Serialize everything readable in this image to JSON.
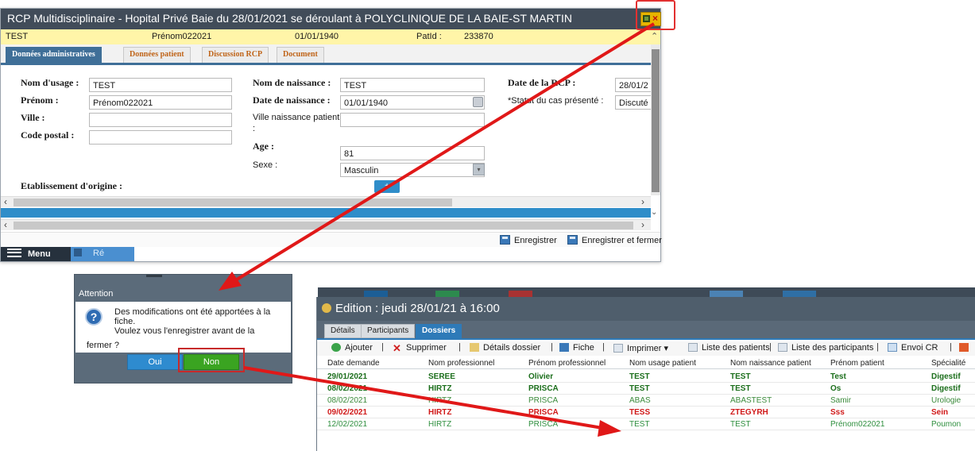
{
  "rcp_window": {
    "title": "RCP Multidisciplinaire - Hopital Privé Baie du 28/01/2021 se déroulant à POLYCLINIQUE DE LA BAIE-ST MARTIN",
    "patient_bar": {
      "nom": "TEST",
      "prenom": "Prénom022021",
      "date_naissance": "01/01/1940",
      "patid_label": "PatId :",
      "patid": "233870"
    },
    "tabs": [
      "Données administratives",
      "Données patient",
      "Discussion RCP",
      "Document"
    ],
    "form": {
      "nom_usage_label": "Nom d'usage :",
      "nom_usage": "TEST",
      "prenom_label": "Prénom :",
      "prenom": "Prénom022021",
      "ville_label": "Ville :",
      "ville": "",
      "code_postal_label": "Code postal :",
      "code_postal": "",
      "nom_naissance_label": "Nom de naissance :",
      "nom_naissance": "TEST",
      "date_naissance_label": "Date de naissance :",
      "date_naissance": "01/01/1940",
      "ville_naissance_label_1": "Ville naissance patient",
      "ville_naissance_label_2": ":",
      "ville_naissance": "",
      "age_label": "Age :",
      "age": "81",
      "sexe_label": "Sexe :",
      "sexe": "Masculin",
      "date_rcp_label": "Date de la RCP :",
      "date_rcp": "28/01/2",
      "statut_label": "*Statut du cas présenté :",
      "statut": "Discuté",
      "etablissement_label": "Etablissement d'origine :",
      "add_btn": "+"
    },
    "save_bar": {
      "save": "Enregistrer",
      "save_close": "Enregistrer et fermer"
    },
    "taskbar": {
      "menu": "Menu",
      "item": "Ré"
    }
  },
  "dialog": {
    "title": "Attention",
    "message_line1": "Des modifications ont été apportées à la fiche.",
    "message_line2": "Voulez vous l'enregistrer avant de la",
    "message_line3": "fermer ?",
    "yes": "Oui",
    "no": "Non"
  },
  "edition_window": {
    "title": "Edition : jeudi 28/01/21 à 16:00",
    "tabs": [
      "Détails",
      "Participants",
      "Dossiers"
    ],
    "toolbar": {
      "ajouter": "Ajouter",
      "supprimer": "Supprimer",
      "details_dossier": "Détails dossier",
      "fiche": "Fiche",
      "imprimer": "Imprimer",
      "liste_patients": "Liste des patients",
      "liste_participants": "Liste des participants",
      "envoi_cr": "Envoi CR"
    },
    "columns": [
      "Date demande",
      "Nom professionnel",
      "Prénom professionnel",
      "Nom usage patient",
      "Nom naissance patient",
      "Prénom patient",
      "Spécialité"
    ],
    "rows": [
      [
        "29/01/2021",
        "SEREE",
        "Olivier",
        "TEST",
        "TEST",
        "Test",
        "Digestif"
      ],
      [
        "08/02/2021",
        "HIRTZ",
        "PRISCA",
        "TEST",
        "TEST",
        "Os",
        "Digestif"
      ],
      [
        "08/02/2021",
        "HIRTZ",
        "PRISCA",
        "ABAS",
        "ABASTEST",
        "Samir",
        "Urologie"
      ],
      [
        "09/02/2021",
        "HIRTZ",
        "PRISCA",
        "TESS",
        "ZTEGYRH",
        "Sss",
        "Sein"
      ],
      [
        "12/02/2021",
        "HIRTZ",
        "PRISCA",
        "TEST",
        "TEST",
        "Prénom022021",
        "Poumon"
      ]
    ],
    "row_styles": [
      "r-green",
      "r-green",
      "r-lgreen",
      "r-red",
      "r-gnormal"
    ]
  },
  "colors": {
    "highlight_red": "#e23030",
    "arrow_red": "#e01818",
    "titlebar": "#414c59",
    "patient_bar": "#fff5a8",
    "tab_active": "#3f6f98"
  }
}
